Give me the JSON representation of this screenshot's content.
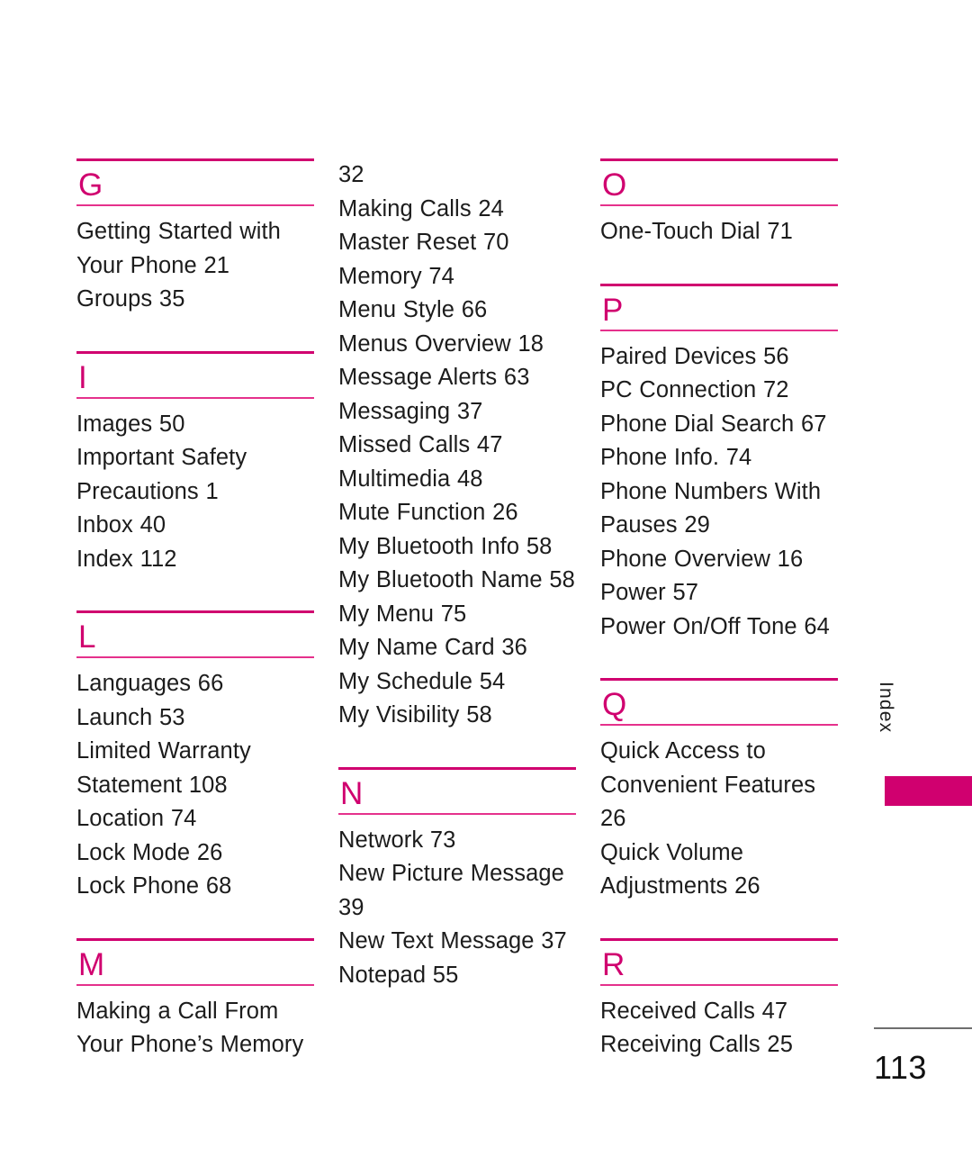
{
  "document": {
    "type": "manual-index-page",
    "page_number": "113",
    "tab_label": "Index",
    "accent_color": "#D0006F",
    "accent_light_color": "#E5318C",
    "text_color": "#1c1c1c",
    "footer_rule_color": "#6e6e6e",
    "background_color": "#ffffff"
  },
  "columns": [
    {
      "id": "column-1",
      "sections": [
        {
          "letter": "G",
          "has_heading": true,
          "entries": [
            "Getting Started with Your Phone 21",
            "Groups 35"
          ]
        },
        {
          "letter": "I",
          "has_heading": true,
          "entries": [
            "Images 50",
            "Important Safety Precautions 1",
            "Inbox 40",
            "Index 112"
          ]
        },
        {
          "letter": "L",
          "has_heading": true,
          "entries": [
            "Languages 66",
            "Launch 53",
            "Limited Warranty Statement 108",
            "Location 74",
            "Lock Mode 26",
            "Lock Phone 68"
          ]
        },
        {
          "letter": "M",
          "has_heading": true,
          "entries": [
            "Making a Call From Your Phone’s Memory"
          ]
        }
      ]
    },
    {
      "id": "column-2",
      "sections": [
        {
          "letter": "",
          "has_heading": false,
          "entries": [
            "32",
            "Making Calls 24",
            "Master Reset 70",
            "Memory 74",
            "Menu Style 66",
            "Menus Overview 18",
            "Message Alerts 63",
            "Messaging 37",
            "Missed Calls 47",
            "Multimedia 48",
            "Mute Function 26",
            "My Bluetooth Info 58",
            "My Bluetooth Name 58",
            "My Menu 75",
            "My Name Card 36",
            "My Schedule 54",
            "My Visibility 58"
          ]
        },
        {
          "letter": "N",
          "has_heading": true,
          "entries": [
            "Network 73",
            "New Picture Message 39",
            "New Text Message 37",
            "Notepad 55"
          ]
        }
      ]
    },
    {
      "id": "column-3",
      "sections": [
        {
          "letter": "O",
          "has_heading": true,
          "entries": [
            "One-Touch Dial 71"
          ]
        },
        {
          "letter": "P",
          "has_heading": true,
          "entries": [
            "Paired Devices 56",
            "PC Connection 72",
            "Phone Dial Search 67",
            "Phone Info. 74",
            "Phone Numbers With Pauses 29",
            "Phone Overview 16",
            "Power 57",
            "Power On/Off Tone 64"
          ]
        },
        {
          "letter": "Q",
          "has_heading": true,
          "entries": [
            "Quick Access to Convenient Features 26",
            "Quick Volume Adjustments 26"
          ]
        },
        {
          "letter": "R",
          "has_heading": true,
          "entries": [
            "Received Calls 47",
            "Receiving Calls 25"
          ]
        }
      ]
    }
  ]
}
